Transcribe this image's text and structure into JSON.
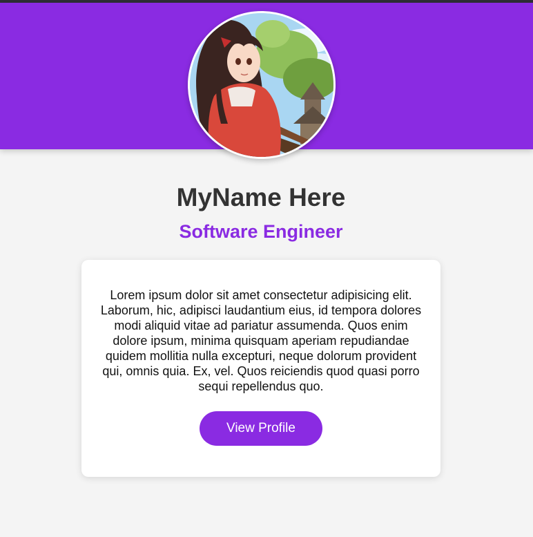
{
  "profile": {
    "name": "MyName Here",
    "title": "Software Engineer",
    "bio": "Lorem ipsum dolor sit amet consectetur adipisicing elit. Laborum, hic, adipisci laudantium eius, id tempora dolores modi aliquid vitae ad pariatur assumenda. Quos enim dolore ipsum, minima quisquam aperiam repudiandae quidem mollitia nulla excepturi, neque dolorum provident qui, omnis quia. Ex, vel. Quos reiciendis quod quasi porro sequi repellendus quo.",
    "button_label": "View Profile",
    "avatar_icon": "anime-girl-portrait-avatar"
  },
  "colors": {
    "accent": "#8a2be2",
    "background": "#f4f4f4",
    "card": "#ffffff",
    "heading": "#333333"
  }
}
